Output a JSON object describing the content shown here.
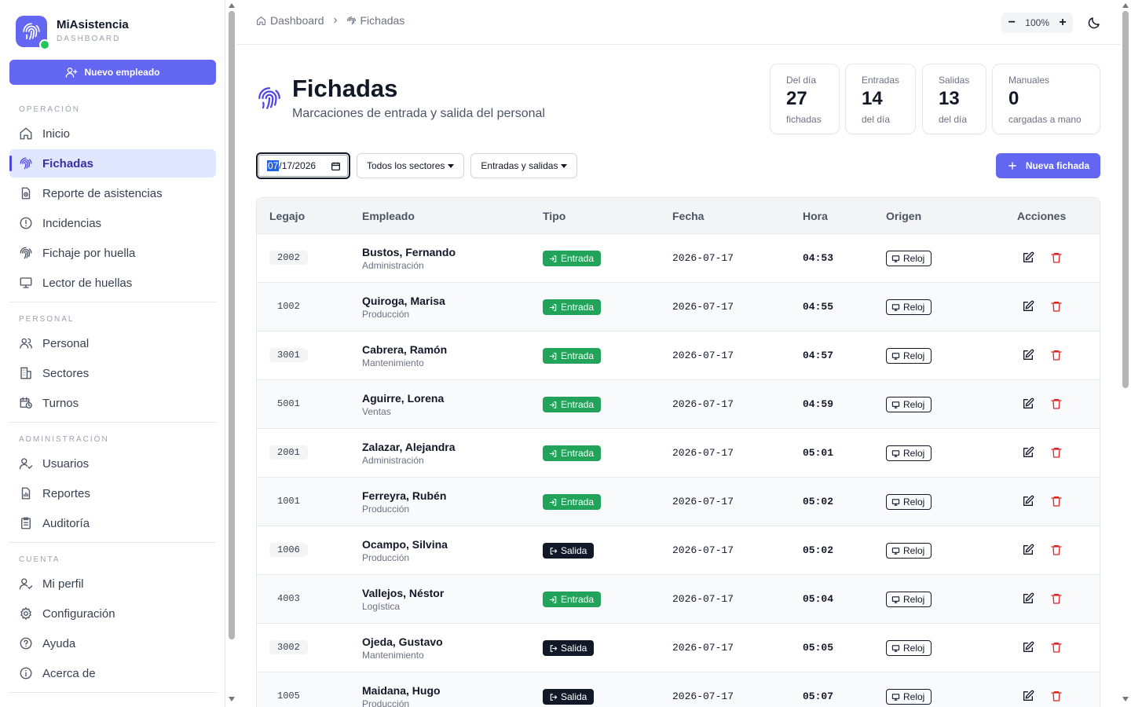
{
  "app": {
    "name": "MiAsistencia",
    "subtitle": "DASHBOARD"
  },
  "sidebar": {
    "new_employee_label": "Nuevo empleado",
    "sections": [
      {
        "title": "OPERACIÓN",
        "items": [
          {
            "label": "Inicio",
            "icon": "home-icon"
          },
          {
            "label": "Fichadas",
            "icon": "fingerprint-icon",
            "active": true
          },
          {
            "label": "Reporte de asistencias",
            "icon": "report-icon"
          },
          {
            "label": "Incidencias",
            "icon": "alert-circle-icon"
          },
          {
            "label": "Fichaje por huella",
            "icon": "fingerprint-icon"
          },
          {
            "label": "Lector de huellas",
            "icon": "monitor-icon"
          }
        ]
      },
      {
        "title": "PERSONAL",
        "items": [
          {
            "label": "Personal",
            "icon": "users-icon"
          },
          {
            "label": "Sectores",
            "icon": "building-icon"
          },
          {
            "label": "Turnos",
            "icon": "calendar-clock-icon"
          }
        ]
      },
      {
        "title": "ADMINISTRACIÓN",
        "items": [
          {
            "label": "Usuarios",
            "icon": "user-check-icon"
          },
          {
            "label": "Reportes",
            "icon": "file-chart-icon"
          },
          {
            "label": "Auditoría",
            "icon": "clipboard-icon"
          }
        ]
      },
      {
        "title": "CUENTA",
        "items": [
          {
            "label": "Mi perfil",
            "icon": "user-icon"
          },
          {
            "label": "Configuración",
            "icon": "gear-icon"
          },
          {
            "label": "Ayuda",
            "icon": "help-icon"
          },
          {
            "label": "Acerca de",
            "icon": "info-icon"
          }
        ]
      }
    ]
  },
  "topbar": {
    "breadcrumb": [
      {
        "label": "Dashboard",
        "icon": "home-icon"
      },
      {
        "label": "Fichadas",
        "icon": "fingerprint-icon"
      }
    ],
    "zoom_minus": "−",
    "zoom": "100%",
    "zoom_plus": "+"
  },
  "page": {
    "title": "Fichadas",
    "subtitle": "Marcaciones de entrada y salida del personal"
  },
  "stats": [
    {
      "label": "Del día",
      "value": "27",
      "note": "fichadas"
    },
    {
      "label": "Entradas",
      "value": "14",
      "note": "del día"
    },
    {
      "label": "Salidas",
      "value": "13",
      "note": "del día"
    },
    {
      "label": "Manuales",
      "value": "0",
      "note": "cargadas a mano"
    }
  ],
  "filters": {
    "date_month": "07",
    "date_rest": "/17/2026",
    "sector": "Todos los sectores",
    "type": "Entradas y salidas",
    "new_label": "Nueva fichada"
  },
  "table": {
    "headers": [
      "Legajo",
      "Empleado",
      "Tipo",
      "Fecha",
      "Hora",
      "Origen",
      "Acciones"
    ],
    "rows": [
      {
        "legajo": "2002",
        "name": "Bustos, Fernando",
        "sector": "Administración",
        "tipo": "Entrada",
        "fecha": "2026-07-17",
        "hora": "04:53",
        "origen": "Reloj"
      },
      {
        "legajo": "1002",
        "name": "Quiroga, Marisa",
        "sector": "Producción",
        "tipo": "Entrada",
        "fecha": "2026-07-17",
        "hora": "04:55",
        "origen": "Reloj"
      },
      {
        "legajo": "3001",
        "name": "Cabrera, Ramón",
        "sector": "Mantenimiento",
        "tipo": "Entrada",
        "fecha": "2026-07-17",
        "hora": "04:57",
        "origen": "Reloj"
      },
      {
        "legajo": "5001",
        "name": "Aguirre, Lorena",
        "sector": "Ventas",
        "tipo": "Entrada",
        "fecha": "2026-07-17",
        "hora": "04:59",
        "origen": "Reloj"
      },
      {
        "legajo": "2001",
        "name": "Zalazar, Alejandra",
        "sector": "Administración",
        "tipo": "Entrada",
        "fecha": "2026-07-17",
        "hora": "05:01",
        "origen": "Reloj"
      },
      {
        "legajo": "1001",
        "name": "Ferreyra, Rubén",
        "sector": "Producción",
        "tipo": "Entrada",
        "fecha": "2026-07-17",
        "hora": "05:02",
        "origen": "Reloj"
      },
      {
        "legajo": "1006",
        "name": "Ocampo, Silvina",
        "sector": "Producción",
        "tipo": "Salida",
        "fecha": "2026-07-17",
        "hora": "05:02",
        "origen": "Reloj"
      },
      {
        "legajo": "4003",
        "name": "Vallejos, Néstor",
        "sector": "Logística",
        "tipo": "Entrada",
        "fecha": "2026-07-17",
        "hora": "05:04",
        "origen": "Reloj"
      },
      {
        "legajo": "3002",
        "name": "Ojeda, Gustavo",
        "sector": "Mantenimiento",
        "tipo": "Salida",
        "fecha": "2026-07-17",
        "hora": "05:05",
        "origen": "Reloj"
      },
      {
        "legajo": "1005",
        "name": "Maidana, Hugo",
        "sector": "Producción",
        "tipo": "Salida",
        "fecha": "2026-07-17",
        "hora": "05:07",
        "origen": "Reloj"
      }
    ]
  },
  "colors": {
    "accent": "#6366f1",
    "entrada": "#22a35a",
    "salida": "#111827",
    "delete": "#dc2626"
  }
}
